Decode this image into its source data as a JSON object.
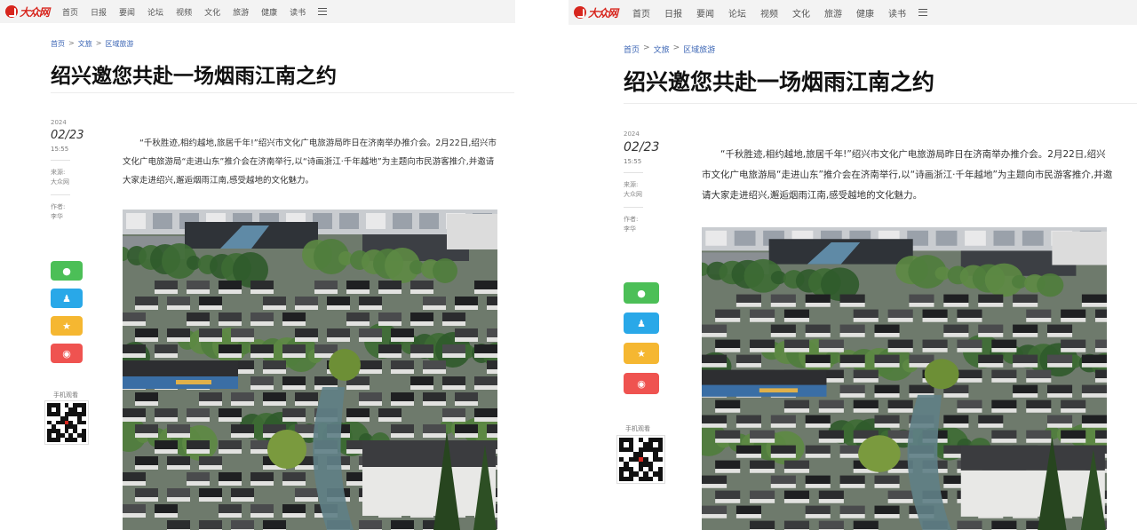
{
  "nav": {
    "logo": "大众网",
    "items": [
      "首页",
      "日报",
      "要闻",
      "论坛",
      "视频",
      "文化",
      "旅游",
      "健康",
      "读书"
    ]
  },
  "breadcrumb": [
    "首页",
    "文旅",
    "区域旅游"
  ],
  "article": {
    "title": "绍兴邀您共赴一场烟雨江南之约",
    "year": "2024",
    "date": "02/23",
    "time": "15:55",
    "source_label": "来源:",
    "source": "大众网",
    "author_label": "作者:",
    "author": "李华",
    "body": "“千秋胜迹,相约越地,旅居千年!”绍兴市文化广电旅游局昨日在济南举办推介会。2月22日,绍兴市文化广电旅游局“走进山东”推介会在济南举行,以“诗画浙江·千年越地”为主题向市民游客推介,并邀请大家走进绍兴,邂逅烟雨江南,感受越地的文化魅力。"
  },
  "share": {
    "wechat_icon": "wechat-icon",
    "qq_icon": "qq-icon",
    "fav_icon": "star-icon",
    "weibo_icon": "weibo-icon"
  },
  "qr": {
    "label": "手机观看"
  },
  "colors": {
    "brand": "#d7261e",
    "link": "#3c66b5",
    "wechat": "#4cbf57",
    "qq": "#29a8e8",
    "fav": "#f5b731",
    "weibo": "#ef5350"
  }
}
